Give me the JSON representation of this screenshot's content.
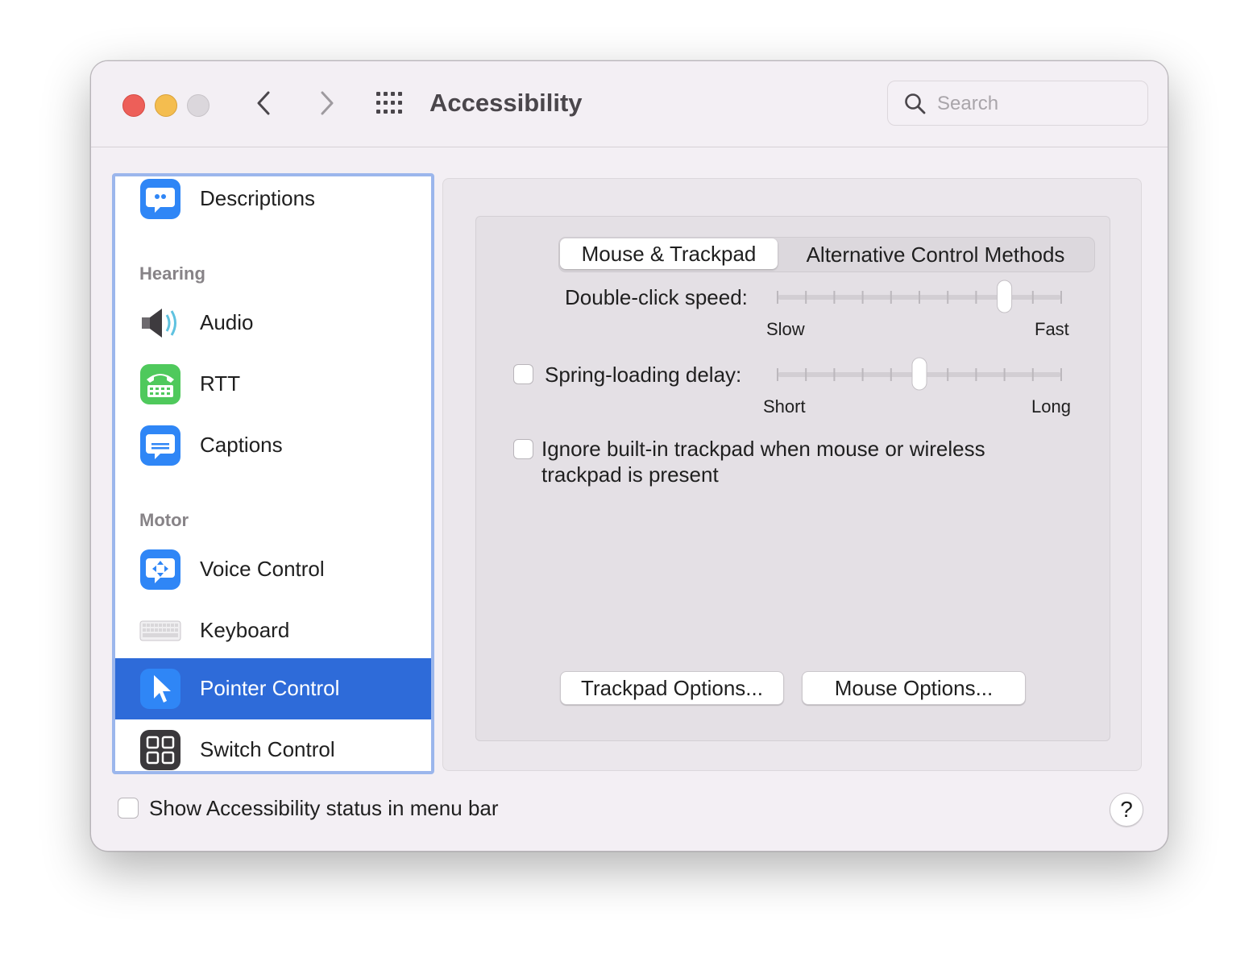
{
  "window": {
    "title": "Accessibility"
  },
  "search": {
    "placeholder": "Search"
  },
  "sidebar": {
    "items": [
      {
        "label": "Descriptions",
        "icon": "speech-bubble-quote-icon"
      },
      {
        "section": "Hearing"
      },
      {
        "label": "Audio",
        "icon": "speaker-icon"
      },
      {
        "label": "RTT",
        "icon": "teletype-phone-icon"
      },
      {
        "label": "Captions",
        "icon": "captions-bubble-icon"
      },
      {
        "section": "Motor"
      },
      {
        "label": "Voice Control",
        "icon": "voice-control-icon"
      },
      {
        "label": "Keyboard",
        "icon": "keyboard-icon"
      },
      {
        "label": "Pointer Control",
        "icon": "pointer-arrow-icon",
        "selected": true
      },
      {
        "label": "Switch Control",
        "icon": "switch-grid-icon"
      }
    ]
  },
  "tabs": [
    {
      "label": "Mouse & Trackpad",
      "active": true
    },
    {
      "label": "Alternative Control Methods",
      "active": false
    }
  ],
  "settings": {
    "double_click": {
      "label": "Double-click speed:",
      "min_label": "Slow",
      "max_label": "Fast",
      "ticks": 11,
      "value_index": 8
    },
    "spring_loading": {
      "label": "Spring-loading delay:",
      "min_label": "Short",
      "max_label": "Long",
      "ticks": 11,
      "value_index": 5,
      "checked": false
    },
    "ignore_trackpad": {
      "label_line1": "Ignore built-in trackpad when mouse or wireless",
      "label_line2": "trackpad is present",
      "checked": false
    }
  },
  "buttons": {
    "trackpad_options": "Trackpad Options...",
    "mouse_options": "Mouse Options..."
  },
  "footer": {
    "status_checkbox_label": "Show Accessibility status in menu bar",
    "status_checked": false,
    "help_label": "?"
  },
  "colors": {
    "selection": "#2e6bd9",
    "focus_ring": "#9bb6ec",
    "close": "#ed5f59",
    "minimize": "#f4bd4f"
  }
}
